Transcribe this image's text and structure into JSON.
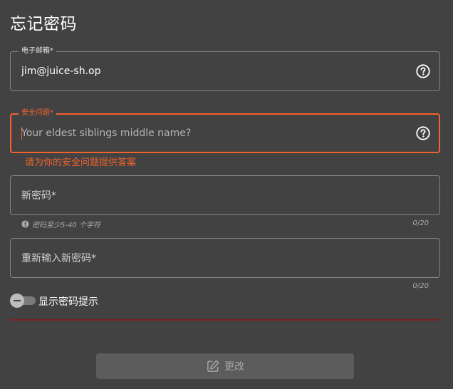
{
  "page": {
    "title": "忘记密码"
  },
  "email": {
    "label": "电子邮箱*",
    "value": "jim@juice-sh.op",
    "help_icon": "help-circle-icon"
  },
  "security_question": {
    "label": "安全问题*",
    "placeholder": "Your eldest siblings middle name?",
    "help_icon": "help-circle-icon",
    "error": "请为你的安全问题提供答案"
  },
  "new_password": {
    "placeholder": "新密码*",
    "hint": "密码至少5-40 个字符",
    "hint_icon": "info-icon",
    "counter": "0/20"
  },
  "repeat_password": {
    "placeholder": "重新输入新密码*",
    "counter": "0/20"
  },
  "toggle": {
    "label": "显示密码提示",
    "checked": false
  },
  "submit": {
    "label": "更改",
    "icon": "edit-icon",
    "disabled": true
  },
  "colors": {
    "background": "#424242",
    "error": "#f2622e",
    "divider": "#7f2020"
  }
}
